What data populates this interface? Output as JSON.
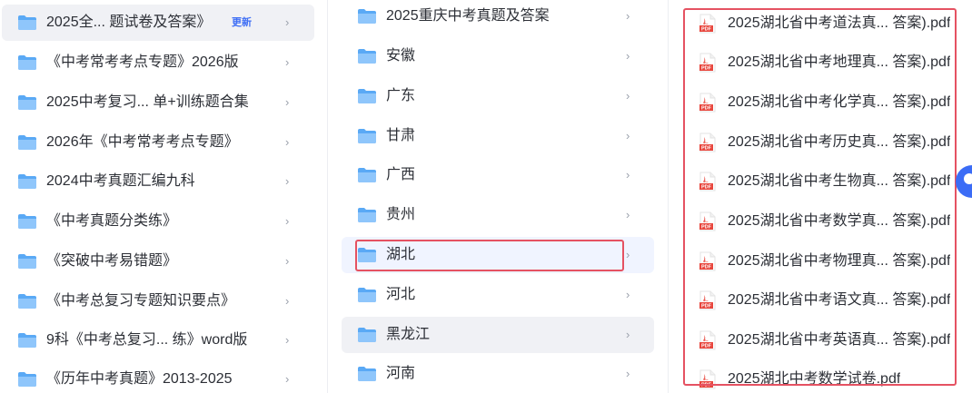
{
  "folders_column": {
    "items": [
      {
        "label": "2025全... 题试卷及答案》",
        "badge": "更新"
      },
      {
        "label": "《中考常考考点专题》2026版"
      },
      {
        "label": "2025中考复习... 单+训练题合集"
      },
      {
        "label": "2026年《中考常考考点专题》"
      },
      {
        "label": "2024中考真题汇编九科"
      },
      {
        "label": "《中考真题分类练》"
      },
      {
        "label": "《突破中考易错题》"
      },
      {
        "label": "《中考总复习专题知识要点》"
      },
      {
        "label": "9科《中考总复习... 练》word版"
      },
      {
        "label": "《历年中考真题》2013-2025"
      }
    ]
  },
  "regions_column": {
    "items": [
      {
        "label": "2025重庆中考真题及答案"
      },
      {
        "label": "安徽"
      },
      {
        "label": "广东"
      },
      {
        "label": "甘肃"
      },
      {
        "label": "广西"
      },
      {
        "label": "贵州"
      },
      {
        "label": "湖北"
      },
      {
        "label": "河北"
      },
      {
        "label": "黑龙江"
      },
      {
        "label": "河南"
      }
    ]
  },
  "files_column": {
    "items": [
      {
        "label": "2025湖北省中考道法真... 答案).pdf"
      },
      {
        "label": "2025湖北省中考地理真... 答案).pdf"
      },
      {
        "label": "2025湖北省中考化学真... 答案).pdf"
      },
      {
        "label": "2025湖北省中考历史真... 答案).pdf"
      },
      {
        "label": "2025湖北省中考生物真... 答案).pdf"
      },
      {
        "label": "2025湖北省中考数学真... 答案).pdf"
      },
      {
        "label": "2025湖北省中考物理真... 答案).pdf"
      },
      {
        "label": "2025湖北省中考语文真... 答案).pdf"
      },
      {
        "label": "2025湖北省中考英语真... 答案).pdf"
      },
      {
        "label": "2025湖北中考数学试卷.pdf"
      }
    ]
  },
  "icons": {
    "folder": "folder-icon",
    "pdf": "pdf-file-icon",
    "chevron": "›",
    "pdf_text": "PDF"
  },
  "colors": {
    "folder_blue": "#5aa9f5",
    "folder_light": "#8fc6fb",
    "pdf_red": "#e8453c",
    "badge_blue": "#3f6ff5",
    "highlight_red": "#e55262",
    "accent_blue": "#3b6cf6"
  }
}
